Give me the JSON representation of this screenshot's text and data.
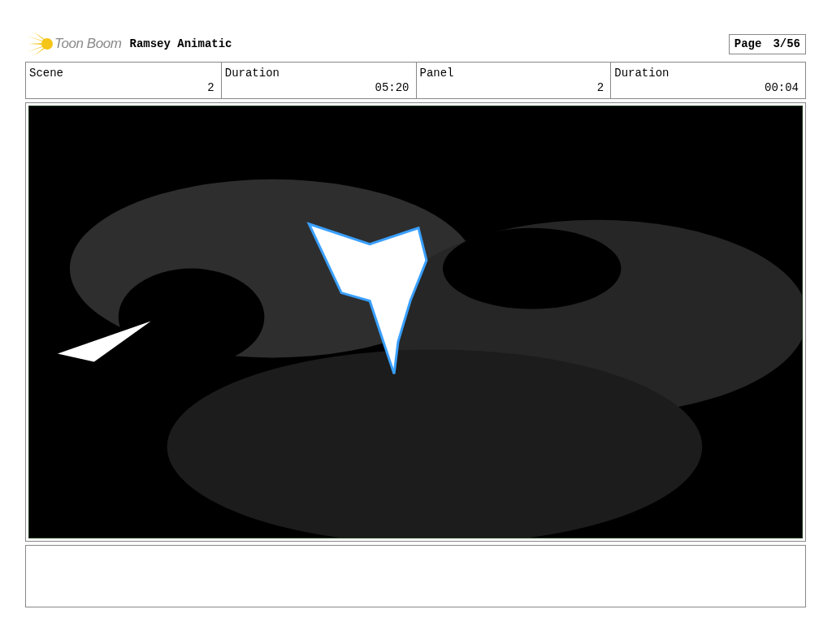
{
  "header": {
    "logo_text": "Toon Boom",
    "title": "Ramsey Animatic",
    "page_label": "Page",
    "page_number": "3/56"
  },
  "info": [
    {
      "label": "Scene",
      "value": "2"
    },
    {
      "label": "Duration",
      "value": "05:20"
    },
    {
      "label": "Panel",
      "value": "2"
    },
    {
      "label": "Duration",
      "value": "00:04"
    }
  ]
}
